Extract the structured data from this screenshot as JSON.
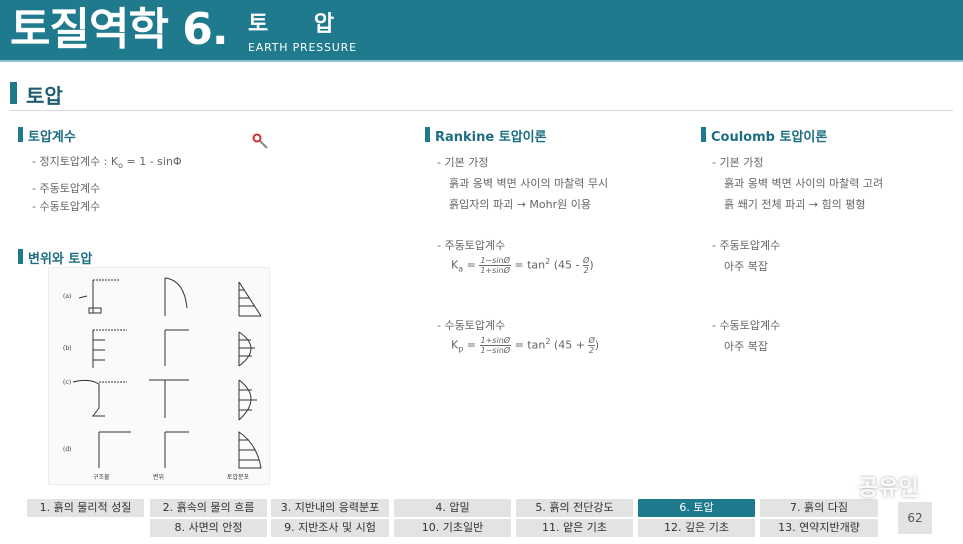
{
  "header": {
    "title": "토질역학 6.",
    "subtitle_ko": "토 압",
    "subtitle_en": "EARTH PRESSURE"
  },
  "section": {
    "title": "토압"
  },
  "col1": {
    "heading1": "토압계수",
    "item1_prefix": "- 정지토압계수 : K",
    "item1_sub": "o",
    "item1_suffix": " = 1 - sinΦ",
    "item2": "- 주동토압계수",
    "item3": "- 수동토압계수",
    "heading2": "변위와 토압",
    "fig_row_labels": [
      "(a)",
      "(b)",
      "(c)",
      "(d)"
    ],
    "fig_captions": [
      "구조물",
      "변위",
      "토압분포"
    ]
  },
  "col2": {
    "heading": "Rankine 토압이론",
    "basic": "- 기본 가정",
    "basic1": "흙과 옹벽 벽면 사이의 마찰력 무시",
    "basic2": "흙입자의 파괴 → Mohr원 이용",
    "active": "- 주동토압계수",
    "ka_sym": "K",
    "ka_sub": "a",
    "ka_num": "1−sinØ",
    "ka_den": "1+sinØ",
    "ka_tail_pre": "= tan",
    "ka_tail_sup": "2",
    "ka_paren_open": "(45 -",
    "ka_phi": "Ø",
    "ka_two": "2",
    "ka_close": ")",
    "passive": "- 수동토압계수",
    "kp_sym": "K",
    "kp_sub": "p",
    "kp_num": "1+sinØ",
    "kp_den": "1−sinØ",
    "kp_tail_pre": "= tan",
    "kp_tail_sup": "2",
    "kp_paren_open": "(45 +",
    "kp_phi": "Ø",
    "kp_two": "2",
    "kp_close": ")"
  },
  "col3": {
    "heading": "Coulomb 토압이론",
    "basic": "- 기본 가정",
    "basic1": "흙과 옹벽 벽면 사이의 마찰력 고려",
    "basic2": "흙 쐐기 전체 파괴 → 힘의 평형",
    "active": "- 주동토압계수",
    "active_val": "아주 복잡",
    "passive": "- 수동토압계수",
    "passive_val": "아주 복잡"
  },
  "nav": {
    "row1": [
      "1. 흙의 물리적 성질",
      "2. 흙속의 물의 흐름",
      "3. 지반내의 응력분포",
      "4. 압밀",
      "5. 흙의 전단강도",
      "6. 토압",
      "7. 흙의 다짐"
    ],
    "row2": [
      "8. 사면의 안정",
      "9. 지반조사 및 시험",
      "10. 기초일반",
      "11. 얕은 기초",
      "12. 깊은 기초",
      "13. 연약지반개량"
    ],
    "active_index": 5
  },
  "page_number": "62",
  "watermark": "공유인",
  "colors": {
    "accent": "#1e7a8c",
    "nav_active": "#1e7a8c",
    "nav_bg": "#e3e3e3"
  }
}
